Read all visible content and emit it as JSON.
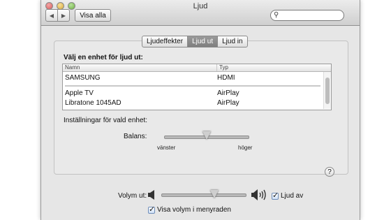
{
  "window": {
    "title": "Ljud"
  },
  "toolbar": {
    "back_icon": "chevron-left-icon",
    "forward_icon": "chevron-right-icon",
    "show_all": "Visa alla",
    "search_placeholder": ""
  },
  "tabs": [
    {
      "label": "Ljudeffekter",
      "active": false
    },
    {
      "label": "Ljud ut",
      "active": true
    },
    {
      "label": "Ljud in",
      "active": false
    }
  ],
  "output": {
    "choose_label": "Välj en enhet för ljud ut:",
    "columns": {
      "name": "Namn",
      "type": "Typ"
    },
    "rows": [
      {
        "name": "SAMSUNG",
        "type": "HDMI"
      },
      {
        "name": "Apple TV",
        "type": "AirPlay"
      },
      {
        "name": "Libratone 1045AD",
        "type": "AirPlay"
      }
    ],
    "settings_label": "Inställningar för vald enhet:",
    "balance_label": "Balans:",
    "balance_left": "vänster",
    "balance_right": "höger",
    "balance_value": 0.5
  },
  "help_label": "?",
  "volume": {
    "label": "Volym ut:",
    "level": 0.67,
    "mute_label": "Ljud av",
    "mute_checked": true,
    "show_in_menu_label": "Visa volym i menyraden",
    "show_in_menu_checked": true
  }
}
